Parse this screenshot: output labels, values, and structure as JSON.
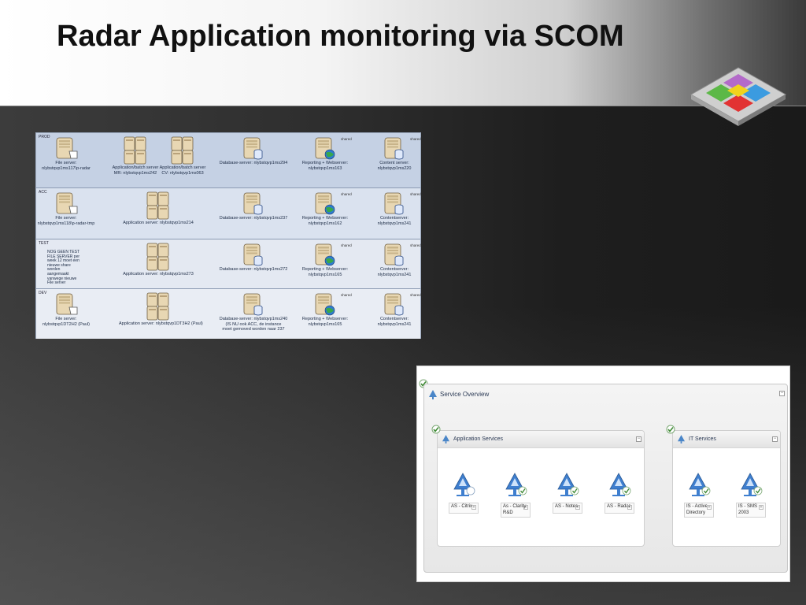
{
  "slide": {
    "title": "Radar Application monitoring via SCOM"
  },
  "diagram": {
    "environments": [
      {
        "label": "PROD",
        "nodes": [
          {
            "type": "file",
            "caption": "File server:\nnlybstqvp1ms117\\p-radar",
            "shared": ""
          },
          {
            "type": "app",
            "caption": "Application/batch server\nMR: nlybstqvp1ms242",
            "shared": ""
          },
          {
            "type": "app",
            "caption": "Application/batch server\nCV: nlybstqvp1ms063",
            "shared": ""
          },
          {
            "type": "db",
            "caption": "Database-server: nlybstqvp1ms294",
            "shared": ""
          },
          {
            "type": "web",
            "caption": "Reporting + Webserver:\nnlybstqvp1ms163",
            "shared": "shared"
          },
          {
            "type": "db",
            "caption": "Content server:\nnlybstqvp1ms220",
            "shared": "shared"
          }
        ]
      },
      {
        "label": "ACC",
        "nodes": [
          {
            "type": "file",
            "caption": "File server:\nnlybstqvp1ms118\\p-radar-tmp",
            "shared": ""
          },
          {
            "type": "app",
            "caption": "Application server: nlybstqvp1ms214",
            "shared": ""
          },
          {
            "type": "db",
            "caption": "Database-server: nlybstqvp1ms237",
            "shared": ""
          },
          {
            "type": "web",
            "caption": "Reporting + Webserver:\nnlybstqvp1ms162",
            "shared": "shared"
          },
          {
            "type": "db",
            "caption": "Contentserver:\nnlybstqvp1ms241",
            "shared": "shared"
          }
        ]
      },
      {
        "label": "TEST",
        "note": "NOG GEEN TEST\nFILE SERVER per\nweek 12 moet een\nnieuwe share\nworden\naangemaakt\nvanwege nieuwe\nFile server",
        "nodes": [
          {
            "type": "app",
            "caption": "Application server: nlybstqvp1ms273",
            "shared": ""
          },
          {
            "type": "db",
            "caption": "Database-server: nlybstqvp1ms272",
            "shared": ""
          },
          {
            "type": "web",
            "caption": "Reporting + Webserver:\nnlybstqvp1ms165",
            "shared": "shared"
          },
          {
            "type": "db",
            "caption": "Contentserver:\nnlybstqvp1ms241",
            "shared": "shared"
          }
        ]
      },
      {
        "label": "DEV",
        "nodes": [
          {
            "type": "file",
            "caption": "File server:\nnlybstqvp1DT2H2 (Paul)",
            "shared": ""
          },
          {
            "type": "app",
            "caption": "Application server: nlybstqvp1DT3H2 (Paul)",
            "shared": ""
          },
          {
            "type": "db",
            "caption": "Database-server: nlybstqvp1ms240\n(IS NU ook ACC, de instance\nmoet gemoved worden naar 237",
            "shared": ""
          },
          {
            "type": "web",
            "caption": "Reporting + Webserver:\nnlybstqvp1ms165",
            "shared": "shared"
          },
          {
            "type": "db",
            "caption": "Contentserver:\nnlybstqvp1ms241",
            "shared": "shared"
          }
        ]
      }
    ]
  },
  "service_overview": {
    "title": "Service Overview",
    "groups": [
      {
        "title": "Application Services",
        "items": [
          {
            "label": "AS - Citrix",
            "status": "unknown"
          },
          {
            "label": "As - Clarity\nR&D",
            "status": "ok"
          },
          {
            "label": "AS - Notes",
            "status": "ok"
          },
          {
            "label": "AS - Radar",
            "status": "ok"
          }
        ]
      },
      {
        "title": "IT Services",
        "items": [
          {
            "label": "IS - Active\nDirectory",
            "status": "ok"
          },
          {
            "label": "IS - SMS\n2003",
            "status": "ok"
          }
        ]
      }
    ]
  }
}
